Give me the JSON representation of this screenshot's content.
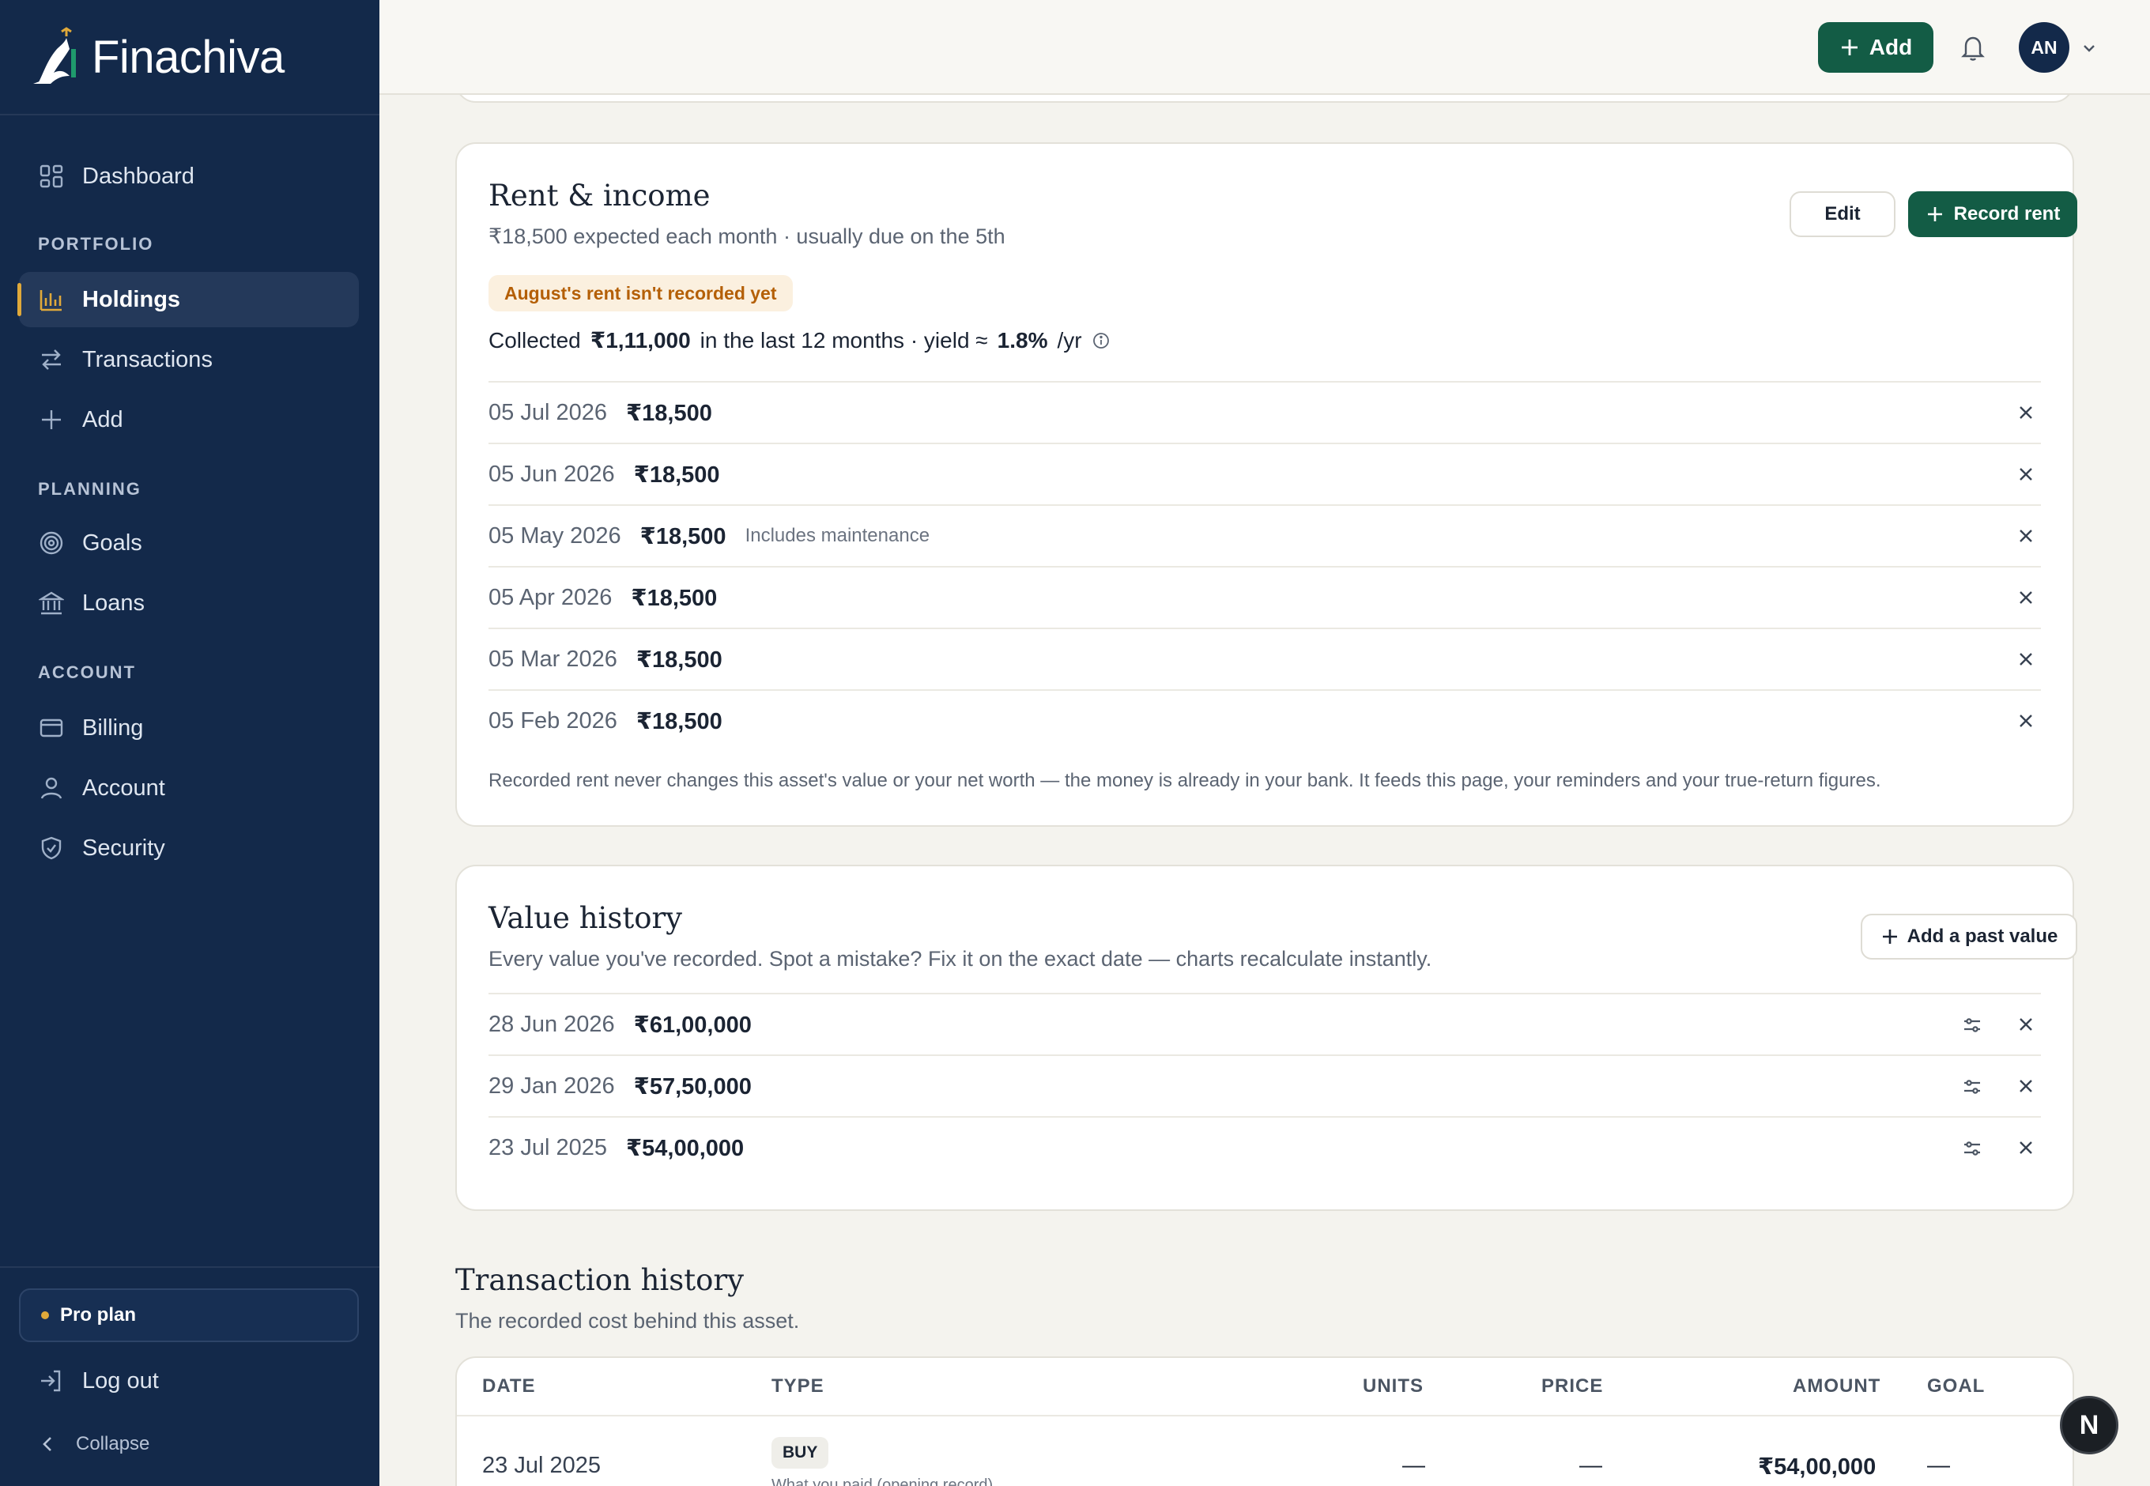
{
  "brand": {
    "name": "Finachiva"
  },
  "sidebar": {
    "items": [
      {
        "label": "Dashboard",
        "icon": "grid-icon"
      },
      {
        "label": "Holdings",
        "icon": "bar-chart-icon",
        "active": true
      },
      {
        "label": "Transactions",
        "icon": "swap-icon"
      },
      {
        "label": "Add",
        "icon": "plus-icon"
      },
      {
        "label": "Goals",
        "icon": "target-icon"
      },
      {
        "label": "Loans",
        "icon": "bank-icon"
      },
      {
        "label": "Billing",
        "icon": "card-icon"
      },
      {
        "label": "Account",
        "icon": "user-icon"
      },
      {
        "label": "Security",
        "icon": "shield-icon"
      }
    ],
    "sections": {
      "portfolio": "PORTFOLIO",
      "planning": "PLANNING",
      "account": "ACCOUNT"
    },
    "plan": "Pro plan",
    "logout": "Log out",
    "collapse": "Collapse"
  },
  "topbar": {
    "add_label": "Add",
    "avatar_initials": "AN"
  },
  "rent": {
    "title": "Rent & income",
    "subtitle": "₹18,500 expected each month · usually due on the 5th",
    "edit_label": "Edit",
    "record_label": "Record rent",
    "warning": "August's rent isn't recorded yet",
    "collected_prefix": "Collected",
    "collected_amount": "₹1,11,000",
    "collected_mid": "in the last 12 months · yield ≈",
    "yield": "1.8%",
    "yield_suffix": "/yr",
    "entries": [
      {
        "date": "05 Jul 2026",
        "amount": "₹18,500",
        "note": ""
      },
      {
        "date": "05 Jun 2026",
        "amount": "₹18,500",
        "note": ""
      },
      {
        "date": "05 May 2026",
        "amount": "₹18,500",
        "note": "Includes maintenance"
      },
      {
        "date": "05 Apr 2026",
        "amount": "₹18,500",
        "note": ""
      },
      {
        "date": "05 Mar 2026",
        "amount": "₹18,500",
        "note": ""
      },
      {
        "date": "05 Feb 2026",
        "amount": "₹18,500",
        "note": ""
      }
    ],
    "footnote": "Recorded rent never changes this asset's value or your net worth — the money is already in your bank. It feeds this page, your reminders and your true-return figures."
  },
  "value_history": {
    "title": "Value history",
    "subtitle": "Every value you've recorded. Spot a mistake? Fix it on the exact date — charts recalculate instantly.",
    "add_label": "Add a past value",
    "entries": [
      {
        "date": "28 Jun 2026",
        "amount": "₹61,00,000"
      },
      {
        "date": "29 Jan 2026",
        "amount": "₹57,50,000"
      },
      {
        "date": "23 Jul 2025",
        "amount": "₹54,00,000"
      }
    ]
  },
  "transactions": {
    "title": "Transaction history",
    "subtitle": "The recorded cost behind this asset.",
    "columns": [
      "DATE",
      "TYPE",
      "UNITS",
      "PRICE",
      "AMOUNT",
      "GOAL"
    ],
    "rows": [
      {
        "date": "23 Jul 2025",
        "type": "BUY",
        "type_sub": "What you paid (opening record)",
        "units": "—",
        "price": "—",
        "amount": "₹54,00,000",
        "goal": "—"
      }
    ]
  },
  "colors": {
    "sidebar": "#13294a",
    "accent_green": "#135c45",
    "warning": "#b45f06",
    "active_marker": "#e0a93a"
  }
}
